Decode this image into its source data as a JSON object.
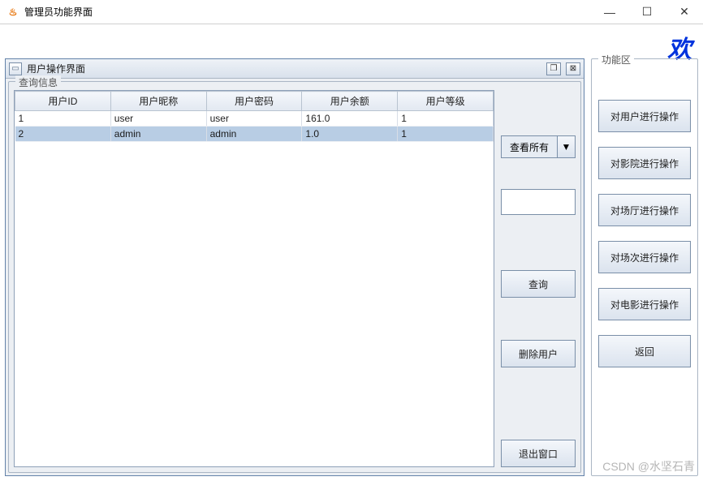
{
  "window": {
    "title": "管理员功能界面",
    "controls": {
      "minimize": "—",
      "maximize": "☐",
      "close": "✕"
    }
  },
  "welcome_char": "欢",
  "internal_frame": {
    "title": "用户操作界面",
    "controls": {
      "maximize": "❐",
      "close": "⊠"
    }
  },
  "fieldset_legend": "查询信息",
  "table": {
    "headers": [
      "用户ID",
      "用户昵称",
      "用户密码",
      "用户余额",
      "用户等级"
    ],
    "rows": [
      {
        "cells": [
          "1",
          "user",
          "user",
          "161.0",
          "1"
        ],
        "selected": false
      },
      {
        "cells": [
          "2",
          "admin",
          "admin",
          "1.0",
          "1"
        ],
        "selected": true
      }
    ]
  },
  "query_panel": {
    "combo_value": "查看所有",
    "combo_arrow": "▼",
    "input_value": "",
    "buttons": {
      "search": "查询",
      "delete_user": "删除用户",
      "exit": "退出窗口"
    }
  },
  "function_panel": {
    "legend": "功能区",
    "buttons": {
      "user_ops": "对用户进行操作",
      "cinema_ops": "对影院进行操作",
      "hall_ops": "对场厅进行操作",
      "session_ops": "对场次进行操作",
      "movie_ops": "对电影进行操作",
      "back": "返回"
    }
  },
  "watermark": "CSDN @水坚石青"
}
